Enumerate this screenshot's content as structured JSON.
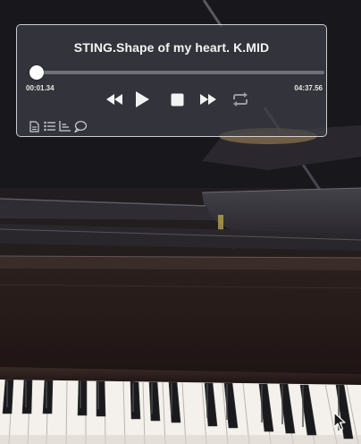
{
  "player": {
    "title": "STING.Shape of my heart. K.MID",
    "elapsed": "00:01.34",
    "total": "04:37.56",
    "progress": 0.005
  },
  "controls": {
    "rewind": "rewind-icon",
    "play": "play-icon",
    "stop": "stop-icon",
    "fast_forward": "fast-forward-icon",
    "repeat": "repeat-icon"
  },
  "tools": {
    "file": "file-icon",
    "list": "list-icon",
    "chart": "chart-icon",
    "chat": "chat-icon"
  },
  "colors": {
    "panel_bg": "#3e3e48",
    "panel_border": "#ffffff",
    "text": "#f2f2f2",
    "repeat_inactive": "#9a9aa4",
    "wood": "#2a1c1a",
    "key_white": "#f4f1ec",
    "key_black": "#1a1a1c"
  }
}
